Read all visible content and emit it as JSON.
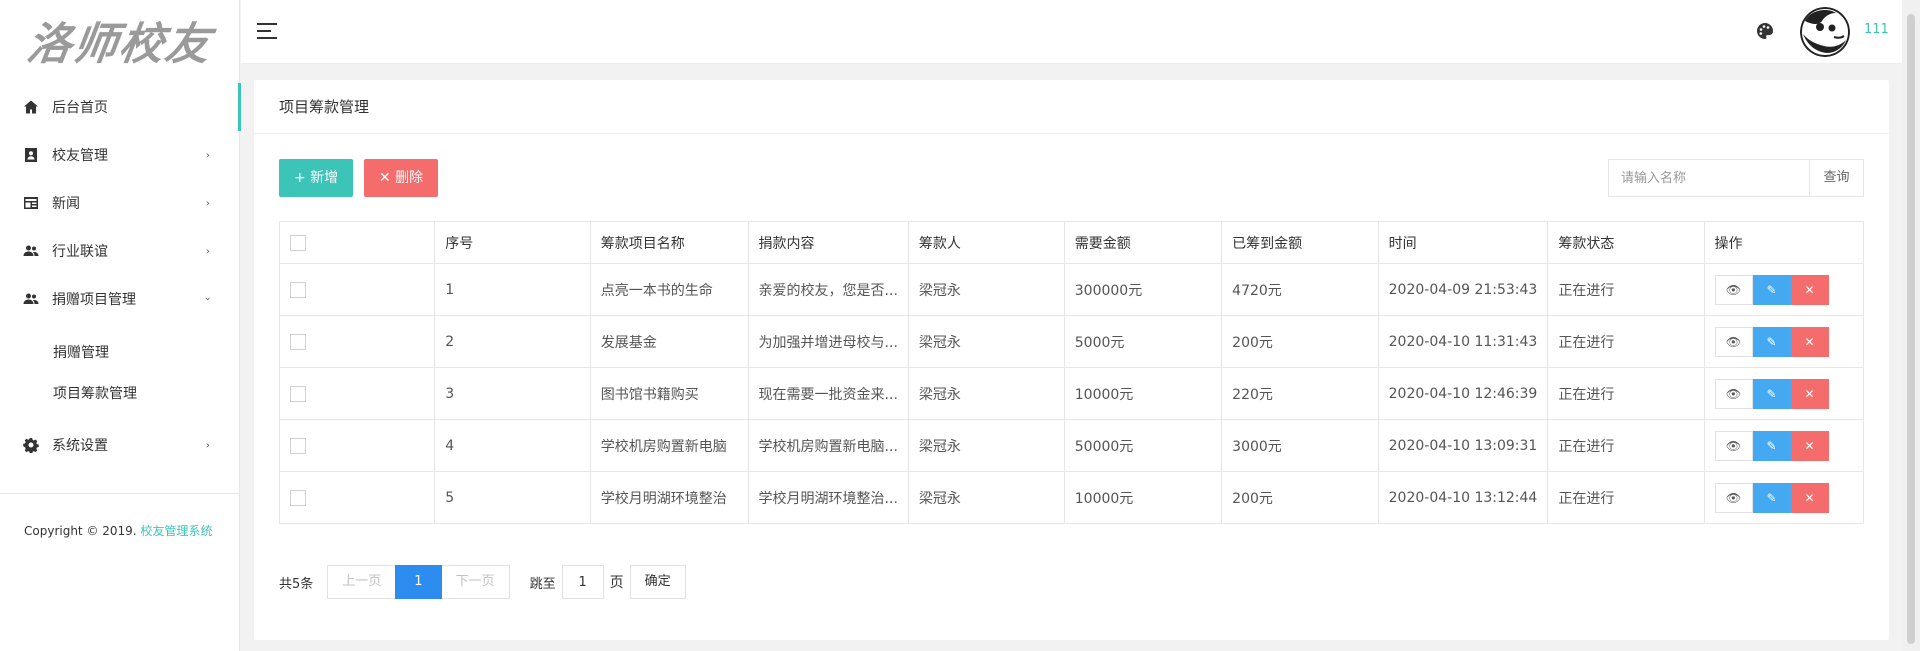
{
  "logo": {
    "text": "洛师校友"
  },
  "sidebar": {
    "items": [
      {
        "label": "后台首页",
        "icon": "home-icon"
      },
      {
        "label": "校友管理",
        "icon": "contact-icon"
      },
      {
        "label": "新闻",
        "icon": "news-icon"
      },
      {
        "label": "行业联谊",
        "icon": "people-icon"
      },
      {
        "label": "捐赠项目管理",
        "icon": "people-icon"
      },
      {
        "label": "系统设置",
        "icon": "gear-icon"
      }
    ],
    "subitems": [
      {
        "label": "捐赠管理"
      },
      {
        "label": "项目筹款管理"
      }
    ],
    "copyright_prefix": "Copyright © 2019. ",
    "copyright_link": "校友管理系统"
  },
  "header": {
    "username": "111"
  },
  "card": {
    "title": "项目筹款管理",
    "add_label": "+ 新增",
    "delete_label": "✕ 删除",
    "search_placeholder": "请输入名称",
    "query_label": "查询"
  },
  "table": {
    "headers": [
      "序号",
      "筹款项目名称",
      "捐款内容",
      "筹款人",
      "需要金额",
      "已筹到金额",
      "时间",
      "筹款状态",
      "操作"
    ],
    "rows": [
      [
        "1",
        "点亮一本书的生命",
        "亲爱的校友，您是否...",
        "梁冠永",
        "300000元",
        "4720元",
        "2020-04-09 21:53:43",
        "正在进行"
      ],
      [
        "2",
        "发展基金",
        "为加强并增进母校与...",
        "梁冠永",
        "5000元",
        "200元",
        "2020-04-10 11:31:43",
        "正在进行"
      ],
      [
        "3",
        "图书馆书籍购买",
        "现在需要一批资金来...",
        "梁冠永",
        "10000元",
        "220元",
        "2020-04-10 12:46:39",
        "正在进行"
      ],
      [
        "4",
        "学校机房购置新电脑",
        "学校机房购置新电脑...",
        "梁冠永",
        "50000元",
        "3000元",
        "2020-04-10 13:09:31",
        "正在进行"
      ],
      [
        "5",
        "学校月明湖环境整治",
        "学校月明湖环境整治...",
        "梁冠永",
        "10000元",
        "200元",
        "2020-04-10 13:12:44",
        "正在进行"
      ]
    ]
  },
  "pagination": {
    "total": "共5条",
    "prev": "上一页",
    "current": "1",
    "next": "下一页",
    "jump_prefix": "跳至",
    "jump_value": "1",
    "jump_suffix": "页",
    "confirm": "确定"
  },
  "colors": {
    "accent": "#3cc4b8",
    "danger": "#f56c6c",
    "info": "#44a9f0",
    "page_active": "#2d8cf0"
  }
}
